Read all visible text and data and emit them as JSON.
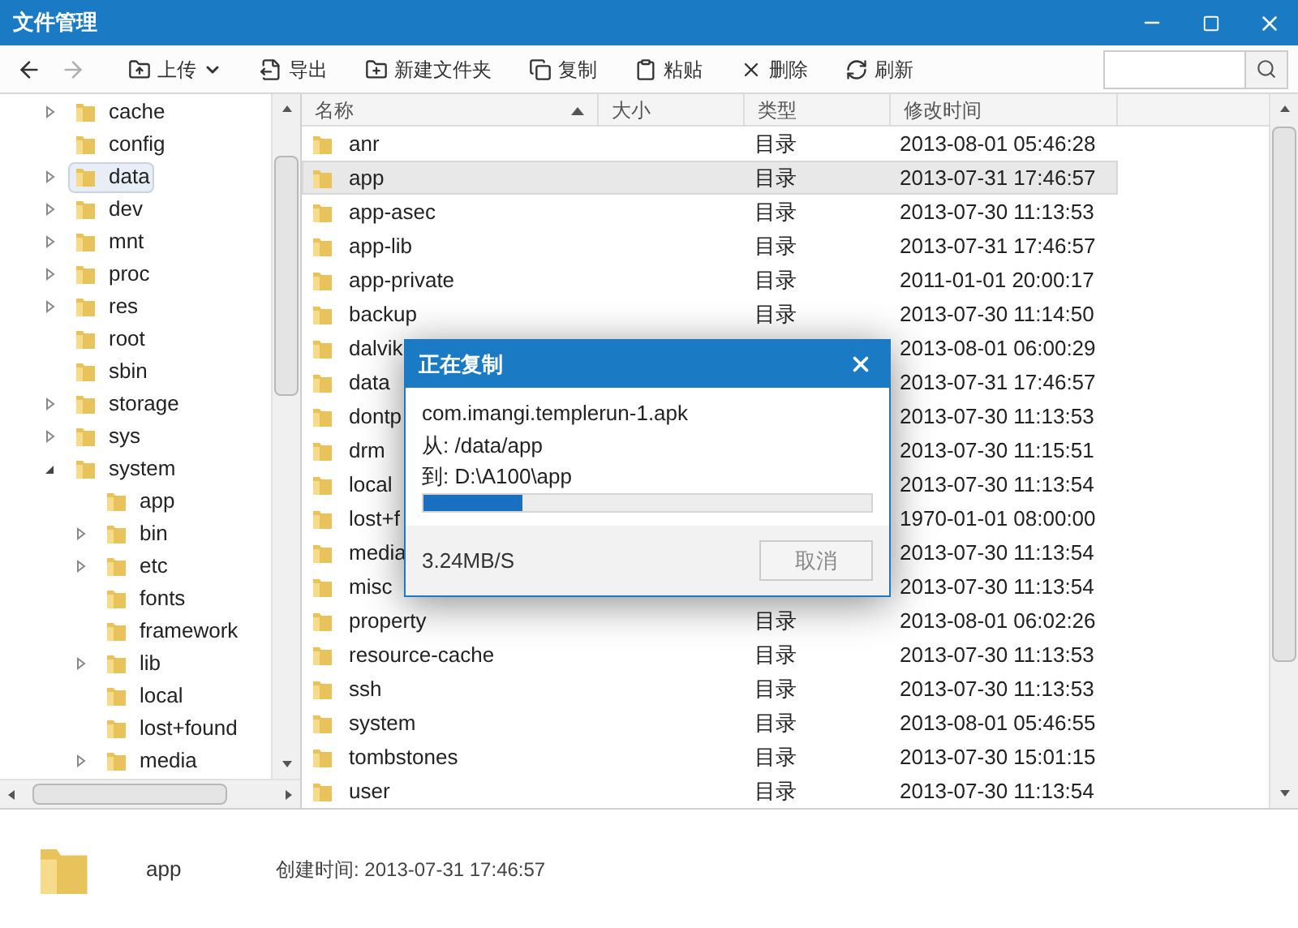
{
  "window": {
    "title": "文件管理"
  },
  "toolbar": {
    "nav": [
      {
        "kind": "back",
        "disabled": false
      },
      {
        "kind": "forward",
        "disabled": true
      }
    ],
    "buttons": [
      {
        "kind": "upload",
        "label": "上传",
        "dropdown": true
      },
      {
        "kind": "export",
        "label": "导出",
        "dropdown": false
      },
      {
        "kind": "new-folder",
        "label": "新建文件夹",
        "dropdown": false
      },
      {
        "kind": "copy",
        "label": "复制",
        "dropdown": false
      },
      {
        "kind": "paste",
        "label": "粘贴",
        "dropdown": false
      },
      {
        "kind": "delete",
        "label": "删除",
        "dropdown": false
      },
      {
        "kind": "refresh",
        "label": "刷新",
        "dropdown": false
      }
    ]
  },
  "tree": [
    {
      "name": "cache",
      "has_children": true,
      "expanded": false,
      "selected": false
    },
    {
      "name": "config",
      "has_children": false,
      "expanded": false,
      "selected": false
    },
    {
      "name": "data",
      "has_children": true,
      "expanded": false,
      "selected": true
    },
    {
      "name": "dev",
      "has_children": true,
      "expanded": false,
      "selected": false
    },
    {
      "name": "mnt",
      "has_children": true,
      "expanded": false,
      "selected": false
    },
    {
      "name": "proc",
      "has_children": true,
      "expanded": false,
      "selected": false
    },
    {
      "name": "res",
      "has_children": true,
      "expanded": false,
      "selected": false
    },
    {
      "name": "root",
      "has_children": false,
      "expanded": false,
      "selected": false
    },
    {
      "name": "sbin",
      "has_children": false,
      "expanded": false,
      "selected": false
    },
    {
      "name": "storage",
      "has_children": true,
      "expanded": false,
      "selected": false
    },
    {
      "name": "sys",
      "has_children": true,
      "expanded": false,
      "selected": false
    },
    {
      "name": "system",
      "has_children": true,
      "expanded": true,
      "selected": false,
      "children": [
        {
          "name": "app",
          "has_children": false,
          "expanded": false,
          "selected": false
        },
        {
          "name": "bin",
          "has_children": true,
          "expanded": false,
          "selected": false
        },
        {
          "name": "etc",
          "has_children": true,
          "expanded": false,
          "selected": false
        },
        {
          "name": "fonts",
          "has_children": false,
          "expanded": false,
          "selected": false
        },
        {
          "name": "framework",
          "has_children": false,
          "expanded": false,
          "selected": false
        },
        {
          "name": "lib",
          "has_children": true,
          "expanded": false,
          "selected": false
        },
        {
          "name": "local",
          "has_children": false,
          "expanded": false,
          "selected": false
        },
        {
          "name": "lost+found",
          "has_children": false,
          "expanded": false,
          "selected": false
        },
        {
          "name": "media",
          "has_children": true,
          "expanded": false,
          "selected": false
        }
      ]
    }
  ],
  "table": {
    "columns": [
      {
        "label": "名称",
        "sorted": true
      },
      {
        "label": "大小",
        "sorted": false
      },
      {
        "label": "类型",
        "sorted": false
      },
      {
        "label": "修改时间",
        "sorted": false
      }
    ],
    "rows": [
      {
        "name": "anr",
        "type": "目录",
        "modified": "2013-08-01 05:46:28",
        "selected": false
      },
      {
        "name": "app",
        "type": "目录",
        "modified": "2013-07-31 17:46:57",
        "selected": true
      },
      {
        "name": "app-asec",
        "type": "目录",
        "modified": "2013-07-30 11:13:53",
        "selected": false
      },
      {
        "name": "app-lib",
        "type": "目录",
        "modified": "2013-07-31 17:46:57",
        "selected": false
      },
      {
        "name": "app-private",
        "type": "目录",
        "modified": "2011-01-01 20:00:17",
        "selected": false
      },
      {
        "name": "backup",
        "type": "目录",
        "modified": "2013-07-30 11:14:50",
        "selected": false
      },
      {
        "name": "dalvik",
        "modified": "2013-08-01 06:00:29",
        "selected": false
      },
      {
        "name": "data",
        "modified": "2013-07-31 17:46:57",
        "selected": false
      },
      {
        "name": "dontp",
        "modified": "2013-07-30 11:13:53",
        "selected": false
      },
      {
        "name": "drm",
        "modified": "2013-07-30 11:15:51",
        "selected": false
      },
      {
        "name": "local",
        "modified": "2013-07-30 11:13:54",
        "selected": false
      },
      {
        "name": "lost+f",
        "modified": "1970-01-01 08:00:00",
        "selected": false
      },
      {
        "name": "media",
        "modified": "2013-07-30 11:13:54",
        "selected": false
      },
      {
        "name": "misc",
        "modified": "2013-07-30 11:13:54",
        "selected": false
      },
      {
        "name": "property",
        "type": "目录",
        "modified": "2013-08-01 06:02:26",
        "selected": false
      },
      {
        "name": "resource-cache",
        "type": "目录",
        "modified": "2013-07-30 11:13:53",
        "selected": false
      },
      {
        "name": "ssh",
        "type": "目录",
        "modified": "2013-07-30 11:13:53",
        "selected": false
      },
      {
        "name": "system",
        "type": "目录",
        "modified": "2013-08-01 05:46:55",
        "selected": false
      },
      {
        "name": "tombstones",
        "type": "目录",
        "modified": "2013-07-30 15:01:15",
        "selected": false
      },
      {
        "name": "user",
        "type": "目录",
        "modified": "2013-07-30 11:13:54",
        "selected": false
      }
    ]
  },
  "details": {
    "name": "app",
    "created": "创建时间: 2013-07-31 17:46:57"
  },
  "dialog": {
    "title": "正在复制",
    "file": "com.imangi.templerun-1.apk",
    "from": "从: /data/app",
    "to": "到: D:\\A100\\app",
    "level": 0.22,
    "speed": "3.24MB/S",
    "cancel": "取消"
  }
}
